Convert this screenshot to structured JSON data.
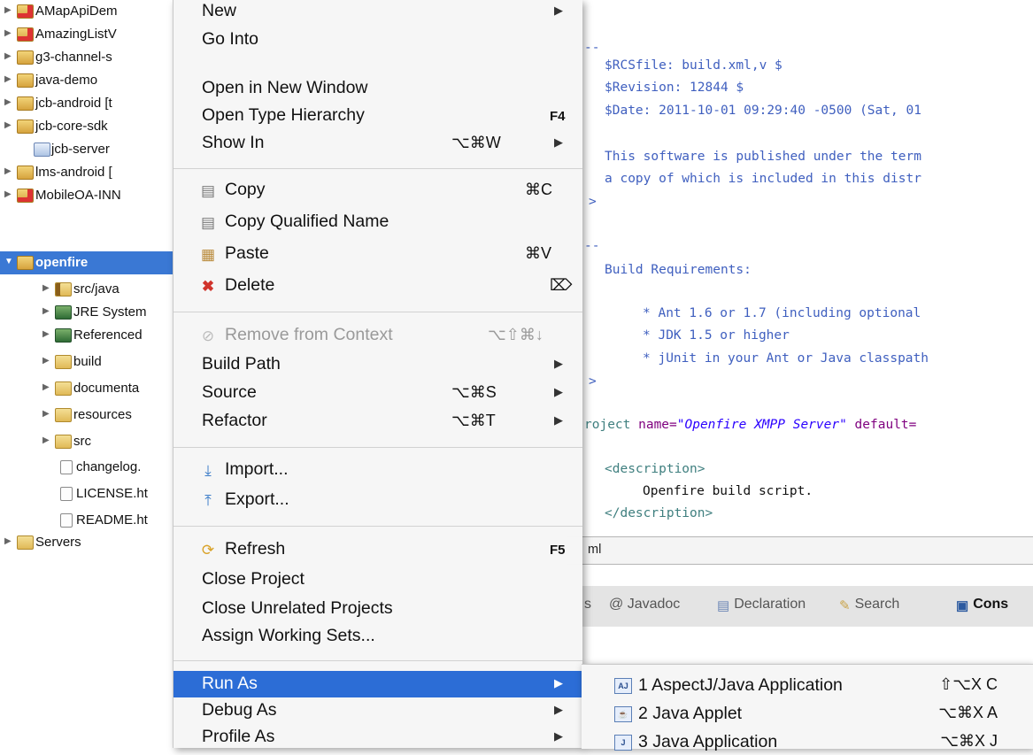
{
  "explorer": {
    "items": [
      {
        "label": "AMapApiDem",
        "icon": "project-error-icon",
        "expandable": true,
        "depth": 0
      },
      {
        "label": "AmazingListV",
        "icon": "android-project-icon",
        "expandable": true,
        "depth": 0
      },
      {
        "label": "g3-channel-s",
        "icon": "java-project-icon",
        "expandable": true,
        "depth": 0
      },
      {
        "label": "java-demo",
        "icon": "maven-project-icon",
        "expandable": true,
        "depth": 0
      },
      {
        "label": "jcb-android [t",
        "icon": "android-project-icon",
        "expandable": true,
        "depth": 0
      },
      {
        "label": "jcb-core-sdk",
        "icon": "maven-project-icon",
        "expandable": true,
        "depth": 0
      },
      {
        "label": "jcb-server",
        "icon": "closed-project-icon",
        "expandable": false,
        "depth": 0
      },
      {
        "label": "lms-android [",
        "icon": "android-project-icon",
        "expandable": true,
        "depth": 0
      },
      {
        "label": "MobileOA-INN",
        "icon": "project-error-icon",
        "expandable": true,
        "depth": 0
      },
      {
        "label": "openfire",
        "icon": "java-project-icon",
        "expandable": true,
        "expanded": true,
        "selected": true,
        "depth": 0
      },
      {
        "label": "src/java",
        "icon": "source-folder-icon",
        "expandable": true,
        "depth": 1
      },
      {
        "label": "JRE System",
        "icon": "library-icon",
        "expandable": true,
        "depth": 1
      },
      {
        "label": "Referenced",
        "icon": "library-icon",
        "expandable": true,
        "depth": 1
      },
      {
        "label": "build",
        "icon": "folder-icon",
        "expandable": true,
        "depth": 1
      },
      {
        "label": "documenta",
        "icon": "folder-icon",
        "expandable": true,
        "depth": 1
      },
      {
        "label": "resources",
        "icon": "folder-icon",
        "expandable": true,
        "depth": 1
      },
      {
        "label": "src",
        "icon": "folder-icon",
        "expandable": true,
        "depth": 1
      },
      {
        "label": "changelog.",
        "icon": "file-icon",
        "expandable": false,
        "depth": 1
      },
      {
        "label": "LICENSE.ht",
        "icon": "file-icon",
        "expandable": false,
        "depth": 1
      },
      {
        "label": "README.ht",
        "icon": "file-icon",
        "expandable": false,
        "depth": 1
      },
      {
        "label": "Servers",
        "icon": "folder-icon",
        "expandable": true,
        "depth": 0
      }
    ]
  },
  "editor": {
    "lines": [
      {
        "text": "--",
        "kind": "comment",
        "indent": 0
      },
      {
        "text": "$RCSfile: build.xml,v $",
        "kind": "comment",
        "indent": 1
      },
      {
        "text": "$Revision: 12844 $",
        "kind": "comment",
        "indent": 1
      },
      {
        "text": "$Date: 2011-10-01 09:29:40 -0500 (Sat, 01",
        "kind": "comment",
        "indent": 1
      },
      {
        "text": "This software is published under the term",
        "kind": "comment",
        "indent": 1
      },
      {
        "text": "a copy of which is included in this distr",
        "kind": "comment",
        "indent": 1
      },
      {
        "text": ">",
        "kind": "comment",
        "indent": 0
      },
      {
        "text": "--",
        "kind": "comment",
        "indent": 0
      },
      {
        "text": "Build Requirements:",
        "kind": "comment",
        "indent": 1
      },
      {
        "text": "* Ant 1.6 or 1.7 (including optional",
        "kind": "comment",
        "indent": 2
      },
      {
        "text": "* JDK 1.5 or higher",
        "kind": "comment",
        "indent": 2
      },
      {
        "text": "* jUnit in your Ant or Java classpath",
        "kind": "comment",
        "indent": 2
      },
      {
        "text": ">",
        "kind": "comment",
        "indent": 0
      },
      {
        "text": "<description>",
        "kind": "tag",
        "indent": 1
      },
      {
        "text": "Openfire build script.",
        "kind": "text",
        "indent": 2
      },
      {
        "text": "</description>",
        "kind": "tag",
        "indent": 1
      }
    ],
    "project_line": {
      "prefix": "roject ",
      "attr1": "name=",
      "val1": "\"Openfire XMPP Server\"",
      "attr2": " default="
    },
    "tab_label": "ml"
  },
  "views": [
    {
      "label": "s",
      "icon": "outline-icon"
    },
    {
      "label": "@ Javadoc",
      "icon": "javadoc-icon"
    },
    {
      "label": "Declaration",
      "icon": "declaration-icon"
    },
    {
      "label": "Search",
      "icon": "search-icon"
    },
    {
      "label": "Cons",
      "icon": "console-icon",
      "active": true
    }
  ],
  "menu": {
    "items": [
      {
        "label": "New",
        "submenu": true
      },
      {
        "label": "Go Into"
      },
      {
        "label": "Open in New Window"
      },
      {
        "label": "Open Type Hierarchy",
        "shortcut": "F4"
      },
      {
        "label": "Show In",
        "shortcut": "⌥⌘W",
        "submenu": true
      },
      {
        "label": "Copy",
        "shortcut": "⌘C",
        "icon": "copy-icon"
      },
      {
        "label": "Copy Qualified Name",
        "icon": "copy-qualified-name-icon"
      },
      {
        "label": "Paste",
        "shortcut": "⌘V",
        "icon": "paste-icon"
      },
      {
        "label": "Delete",
        "shortcut": "⌦",
        "icon": "delete-icon"
      },
      {
        "label": "Remove from Context",
        "shortcut": "⌥⇧⌘↓",
        "icon": "remove-context-icon",
        "disabled": true
      },
      {
        "label": "Build Path",
        "submenu": true
      },
      {
        "label": "Source",
        "shortcut": "⌥⌘S",
        "submenu": true
      },
      {
        "label": "Refactor",
        "shortcut": "⌥⌘T",
        "submenu": true
      },
      {
        "label": "Import...",
        "icon": "import-icon"
      },
      {
        "label": "Export...",
        "icon": "export-icon"
      },
      {
        "label": "Refresh",
        "shortcut": "F5",
        "icon": "refresh-icon"
      },
      {
        "label": "Close Project"
      },
      {
        "label": "Close Unrelated Projects"
      },
      {
        "label": "Assign Working Sets..."
      },
      {
        "label": "Run As",
        "submenu": true,
        "highlighted": true
      },
      {
        "label": "Debug As",
        "submenu": true
      },
      {
        "label": "Profile As",
        "submenu": true
      }
    ]
  },
  "run_as_submenu": {
    "items": [
      {
        "label": "1 AspectJ/Java Application",
        "shortcut": "⇧⌥X C",
        "icon": "aspectj-app-icon"
      },
      {
        "label": "2 Java Applet",
        "shortcut": "⌥⌘X A",
        "icon": "java-applet-icon"
      },
      {
        "label": "3 Java Application",
        "shortcut": "⌥⌘X J",
        "icon": "java-app-icon"
      }
    ]
  },
  "colors": {
    "selection": "#3a78d4",
    "menu_highlight": "#2c6dd6",
    "comment": "#3f5fbf",
    "xml_tag": "#3f7f7f",
    "xml_attr": "#7f007f",
    "xml_value": "#2a00ff"
  }
}
